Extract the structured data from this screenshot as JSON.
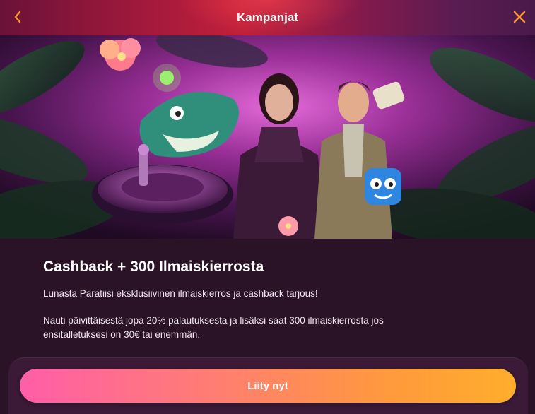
{
  "header": {
    "title": "Kampanjat",
    "back_icon": "chevron-left-icon",
    "close_icon": "close-icon",
    "accent_color": "#ff9a2a"
  },
  "hero": {
    "description_icons": [
      "shark-mascot",
      "roulette-wheel",
      "woman-presenter",
      "adventurer-man",
      "blue-dice-mascot",
      "hibiscus-flower"
    ]
  },
  "promo": {
    "title": "Cashback + 300 Ilmaiskierrosta",
    "intro": "Lunasta Paratiisi eksklusiivinen ilmaiskierros ja cashback tarjous!",
    "details": "Nauti päivittäisestä jopa 20% palautuksesta ja lisäksi saat 300 ilmaiskierrosta jos ensitalletuksesi on 30€ tai enemmän."
  },
  "cta": {
    "label": "Liity nyt"
  }
}
